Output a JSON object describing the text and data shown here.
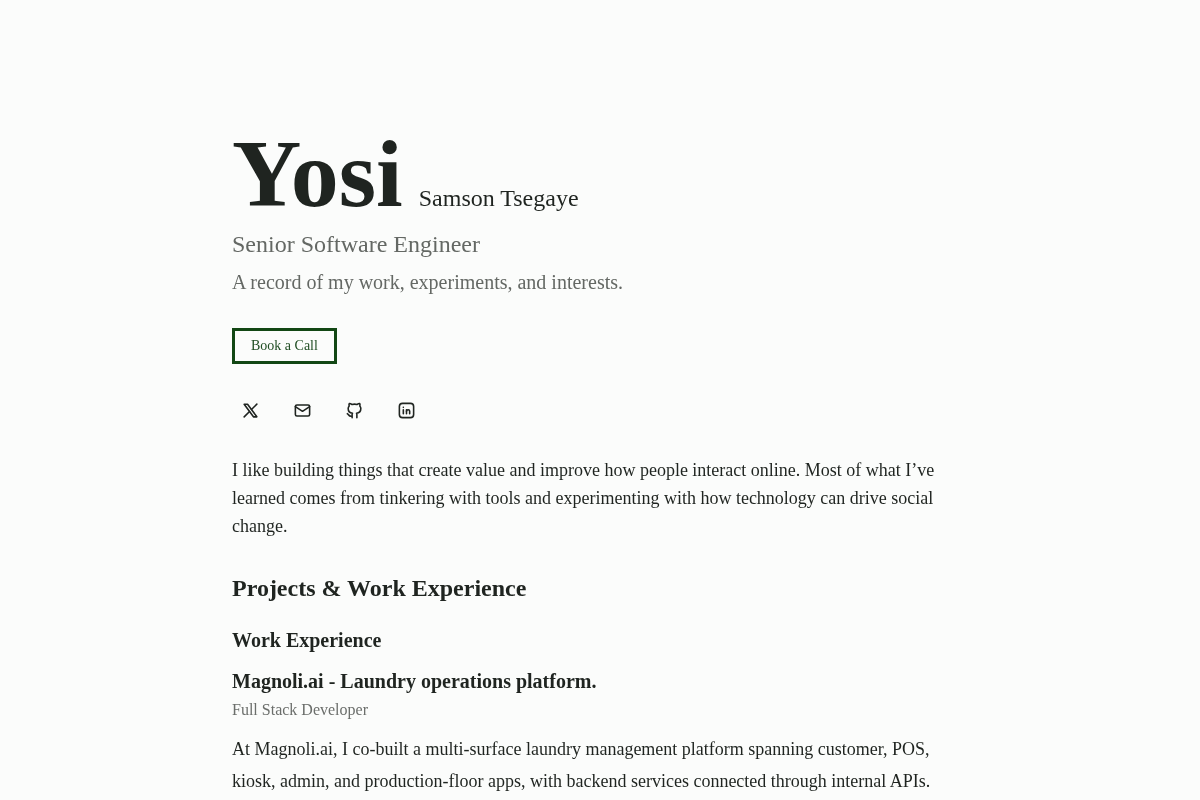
{
  "header": {
    "name": "Yosi",
    "full_name": "Samson Tsegaye",
    "role": "Senior Software Engineer",
    "tagline": "A record of my work, experiments, and interests."
  },
  "cta_button": "Book a Call",
  "social_links": [
    {
      "kind": "x"
    },
    {
      "kind": "mail"
    },
    {
      "kind": "github"
    },
    {
      "kind": "linkedin"
    }
  ],
  "intro": "I like building things that create value and improve how people interact online. Most of what I’ve learned comes from tinkering with tools and experimenting with how technology can drive social change.",
  "section": {
    "title": "Projects & Work Experience",
    "subsection": "Work Experience",
    "entries": [
      {
        "title": "Magnoli.ai - Laundry operations platform.",
        "role": "Full Stack Developer",
        "description": "At Magnoli.ai, I co-built a multi-surface laundry management platform spanning customer, POS, kiosk, admin, and production-floor apps, with backend services connected through internal APIs."
      }
    ]
  }
}
